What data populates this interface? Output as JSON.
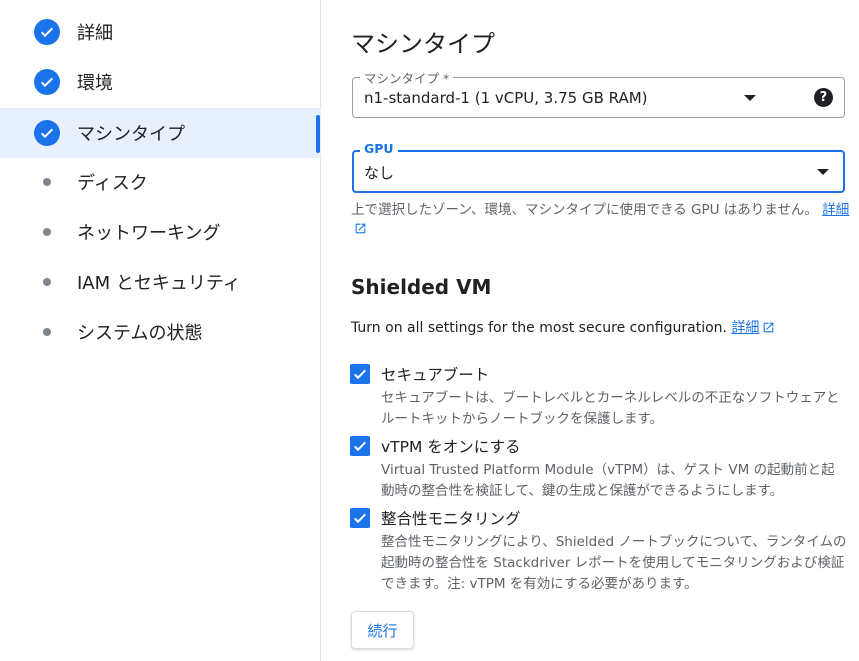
{
  "sidebar": {
    "steps": [
      {
        "label": "詳細",
        "state": "complete",
        "icon": "check-circle-icon"
      },
      {
        "label": "環境",
        "state": "complete",
        "icon": "check-circle-icon"
      },
      {
        "label": "マシンタイプ",
        "state": "complete-active",
        "icon": "check-circle-icon"
      },
      {
        "label": "ディスク",
        "state": "pending",
        "icon": "dot-icon"
      },
      {
        "label": "ネットワーキング",
        "state": "pending",
        "icon": "dot-icon"
      },
      {
        "label": "IAM とセキュリティ",
        "state": "pending",
        "icon": "dot-icon"
      },
      {
        "label": "システムの状態",
        "state": "pending",
        "icon": "dot-icon"
      }
    ]
  },
  "main": {
    "title": "マシンタイプ",
    "machine_type": {
      "label": "マシンタイプ *",
      "value": "n1-standard-1 (1 vCPU, 3.75 GB RAM)",
      "help_glyph": "?"
    },
    "gpu": {
      "label": "GPU",
      "value": "なし"
    },
    "gpu_hint": {
      "text": "上で選択したゾーン、環境、マシンタイプに使用できる GPU はありません。",
      "link": "詳細"
    },
    "shielded": {
      "title": "Shielded VM",
      "description": "Turn on all settings for the most secure configuration.",
      "link": "詳細",
      "options": [
        {
          "title": "セキュアブート",
          "description": "セキュアブートは、ブートレベルとカーネルレベルの不正なソフトウェアとルートキットからノートブックを保護します。",
          "checked": true
        },
        {
          "title": "vTPM をオンにする",
          "description": "Virtual Trusted Platform Module（vTPM）は、ゲスト VM の起動前と起動時の整合性を検証して、鍵の生成と保護ができるようにします。",
          "checked": true
        },
        {
          "title": "整合性モニタリング",
          "description": "整合性モニタリングにより、Shielded ノートブックについて、ランタイムの起動時の整合性を Stackdriver レポートを使用してモニタリングおよび検証できます。注: vTPM を有効にする必要があります。",
          "checked": true
        }
      ]
    },
    "continue_label": "続行"
  },
  "colors": {
    "accent": "#1a73e8",
    "active_bg": "#e8f0fe",
    "secondary_text": "#5f6368"
  }
}
